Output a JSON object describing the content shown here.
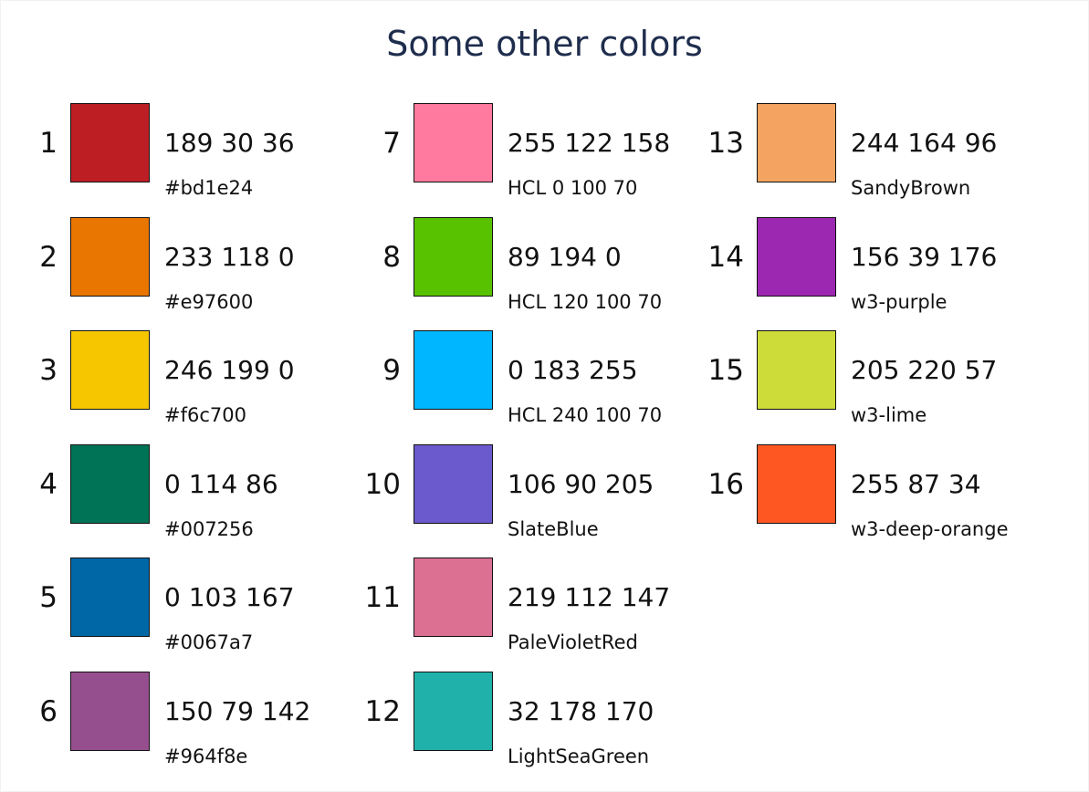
{
  "title": "Some other colors",
  "colors": [
    {
      "number": "1",
      "rgb": "189 30 36",
      "label": "#bd1e24",
      "hex": "#bd1e24"
    },
    {
      "number": "2",
      "rgb": "233 118 0",
      "label": "#e97600",
      "hex": "#e97600"
    },
    {
      "number": "3",
      "rgb": "246 199 0",
      "label": "#f6c700",
      "hex": "#f6c700"
    },
    {
      "number": "4",
      "rgb": "0 114 86",
      "label": "#007256",
      "hex": "#007256"
    },
    {
      "number": "5",
      "rgb": "0 103 167",
      "label": "#0067a7",
      "hex": "#0067a7"
    },
    {
      "number": "6",
      "rgb": "150 79 142",
      "label": "#964f8e",
      "hex": "#964f8e"
    },
    {
      "number": "7",
      "rgb": "255 122 158",
      "label": "HCL 0 100 70",
      "hex": "#ff7a9e"
    },
    {
      "number": "8",
      "rgb": "89 194 0",
      "label": "HCL 120 100 70",
      "hex": "#59c200"
    },
    {
      "number": "9",
      "rgb": "0 183 255",
      "label": "HCL 240 100 70",
      "hex": "#00b7ff"
    },
    {
      "number": "10",
      "rgb": "106 90 205",
      "label": "SlateBlue",
      "hex": "#6a5acd"
    },
    {
      "number": "11",
      "rgb": "219 112 147",
      "label": "PaleVioletRed",
      "hex": "#db7093"
    },
    {
      "number": "12",
      "rgb": "32 178 170",
      "label": "LightSeaGreen",
      "hex": "#20b2aa"
    },
    {
      "number": "13",
      "rgb": "244 164 96",
      "label": "SandyBrown",
      "hex": "#f4a460"
    },
    {
      "number": "14",
      "rgb": "156 39 176",
      "label": "w3-purple",
      "hex": "#9c27b0"
    },
    {
      "number": "15",
      "rgb": "205 220 57",
      "label": "w3-lime",
      "hex": "#cddc39"
    },
    {
      "number": "16",
      "rgb": "255 87 34",
      "label": "w3-deep-orange",
      "hex": "#ff5722"
    }
  ]
}
